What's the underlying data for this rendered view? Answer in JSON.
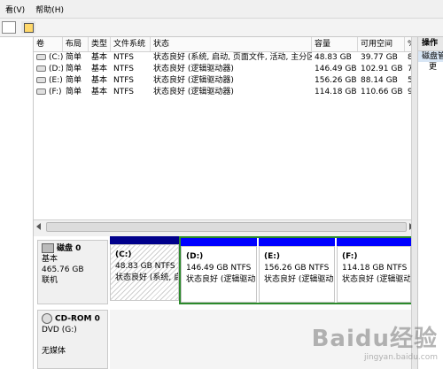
{
  "menu": {
    "items": [
      "看(V)",
      "帮助(H)"
    ]
  },
  "volume_table": {
    "columns": [
      "卷",
      "布局",
      "类型",
      "文件系统",
      "状态",
      "容量",
      "可用空间",
      "%"
    ],
    "rows": [
      [
        "(C:)",
        "简单",
        "基本",
        "NTFS",
        "状态良好 (系统, 启动, 页面文件, 活动, 主分区)",
        "48.83 GB",
        "39.77 GB",
        "8"
      ],
      [
        "(D:)",
        "简单",
        "基本",
        "NTFS",
        "状态良好 (逻辑驱动器)",
        "146.49 GB",
        "102.91 GB",
        "7"
      ],
      [
        "(E:)",
        "简单",
        "基本",
        "NTFS",
        "状态良好 (逻辑驱动器)",
        "156.26 GB",
        "88.14 GB",
        "5"
      ],
      [
        "(F:)",
        "简单",
        "基本",
        "NTFS",
        "状态良好 (逻辑驱动器)",
        "114.18 GB",
        "110.66 GB",
        "9"
      ]
    ]
  },
  "disk0": {
    "name": "磁盘 0",
    "type": "基本",
    "size": "465.76 GB",
    "status": "联机",
    "partitions": [
      {
        "letter": "(C:)",
        "size": "48.83 GB NTFS",
        "status": "状态良好 (系统, 启"
      },
      {
        "letter": "(D:)",
        "size": "146.49 GB NTFS",
        "status": "状态良好 (逻辑驱动"
      },
      {
        "letter": "(E:)",
        "size": "156.26 GB NTFS",
        "status": "状态良好 (逻辑驱动"
      },
      {
        "letter": "(F:)",
        "size": "114.18 GB NTFS",
        "status": "状态良好 (逻辑驱动"
      }
    ]
  },
  "cdrom0": {
    "name": "CD-ROM 0",
    "type": "DVD (G:)",
    "status": "无媒体"
  },
  "actions": {
    "title": "操作",
    "item1": "磁盘管",
    "item2": "更"
  },
  "watermark": {
    "big": "Baidu经验",
    "small": "jingyan.baidu.com"
  },
  "colors": {
    "primary_bar": "#00008b",
    "logical_bar": "#0000ff",
    "extended_border": "#2c8a2c"
  }
}
